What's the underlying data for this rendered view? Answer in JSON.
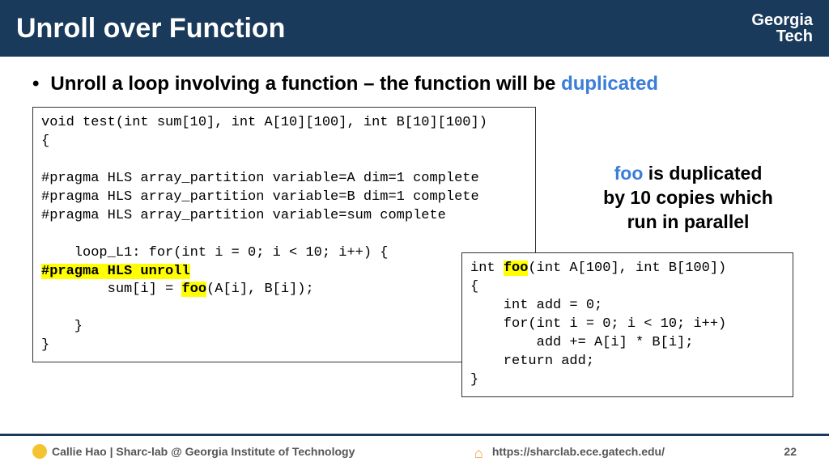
{
  "header": {
    "title": "Unroll over Function",
    "logo_top": "Georgia",
    "logo_bot": "Tech"
  },
  "bullet": {
    "pre": "Unroll a loop involving a function – the function will be ",
    "hl": "duplicated"
  },
  "code1": {
    "l1": "void test(int sum[10], int A[10][100], int B[10][100])",
    "l2": "{",
    "l3": "",
    "l4": "#pragma HLS array_partition variable=A dim=1 complete",
    "l5": "#pragma HLS array_partition variable=B dim=1 complete",
    "l6": "#pragma HLS array_partition variable=sum complete",
    "l7": "",
    "l8": "    loop_L1: for(int i = 0; i < 10; i++) {",
    "l9": "#pragma HLS unroll",
    "l10a": "        sum[i] = ",
    "l10b": "foo",
    "l10c": "(A[i], B[i]);",
    "l11": "",
    "l12": "    }",
    "l13": "}"
  },
  "callout": {
    "foo": "foo",
    "rest1": " is duplicated",
    "rest2": "by 10 copies which",
    "rest3": "run in parallel"
  },
  "code2": {
    "l1a": "int ",
    "l1b": "foo",
    "l1c": "(int A[100], int B[100])",
    "l2": "{",
    "l3": "    int add = 0;",
    "l4": "    for(int i = 0; i < 10; i++)",
    "l5": "        add += A[i] * B[i];",
    "l6": "    return add;",
    "l7": "}"
  },
  "footer": {
    "left": "Callie Hao | Sharc-lab @ Georgia Institute of Technology",
    "mid": "https://sharclab.ece.gatech.edu/",
    "page": "22"
  }
}
